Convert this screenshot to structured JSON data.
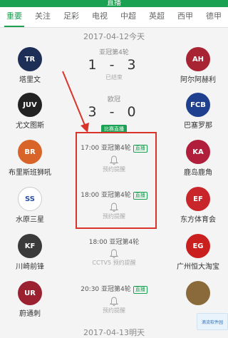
{
  "header": {
    "title": "直播"
  },
  "tabs": [
    "重要",
    "关注",
    "足彩",
    "电视",
    "中超",
    "英超",
    "西甲",
    "德甲"
  ],
  "dates": {
    "first": "2017-04-12今天",
    "second": "2017-04-13明天"
  },
  "matches": [
    {
      "home": "塔里文",
      "away": "阿尔阿赫利",
      "round": "亚冠第4轮",
      "score": "1 - 3",
      "sub": "已结束",
      "home_color": "#1e2f57",
      "away_color": "#a92433",
      "home_abbr": "TR",
      "away_abbr": "AH"
    },
    {
      "home": "尤文图斯",
      "away": "巴塞罗那",
      "round": "欧冠",
      "score": "3 - 0",
      "sub": "",
      "pill": "比赛直播",
      "home_color": "#222222",
      "away_color": "#1f3f8f",
      "home_abbr": "JUV",
      "away_abbr": "FCB"
    },
    {
      "home": "布里斯班狮吼",
      "away": "鹿岛鹿角",
      "time": "17:00",
      "round": "亚冠第4轮",
      "tag": "直播",
      "sub": "预约提醒",
      "home_color": "#d8642a",
      "away_color": "#b01e3c",
      "home_abbr": "BR",
      "away_abbr": "KA"
    },
    {
      "home": "水原三星",
      "away": "东方体育会",
      "time": "18:00",
      "round": "亚冠第4轮",
      "tag": "直播",
      "sub": "预约提醒",
      "home_color": "#ffffff",
      "away_color": "#c8262b",
      "home_abbr": "SS",
      "away_abbr": "EF"
    },
    {
      "home": "川崎前锋",
      "away": "广州恒大淘宝",
      "time": "18:00",
      "round": "亚冠第4轮",
      "tag": "",
      "sub": "CCTV5 预约提醒",
      "home_color": "#3a3a3a",
      "away_color": "#c9201f",
      "home_abbr": "KF",
      "away_abbr": "EG"
    },
    {
      "home": "蔚通刺",
      "away": "",
      "time": "20:30",
      "round": "亚冠第4轮",
      "tag": "直播",
      "sub": "预约提醒",
      "home_color": "#9b2030",
      "away_color": "#8a6a3a",
      "home_abbr": "UR",
      "away_abbr": ""
    }
  ],
  "watermark": "滴流软件园",
  "colors": {
    "accent": "#1aa152",
    "highlight": "#d9342b"
  }
}
